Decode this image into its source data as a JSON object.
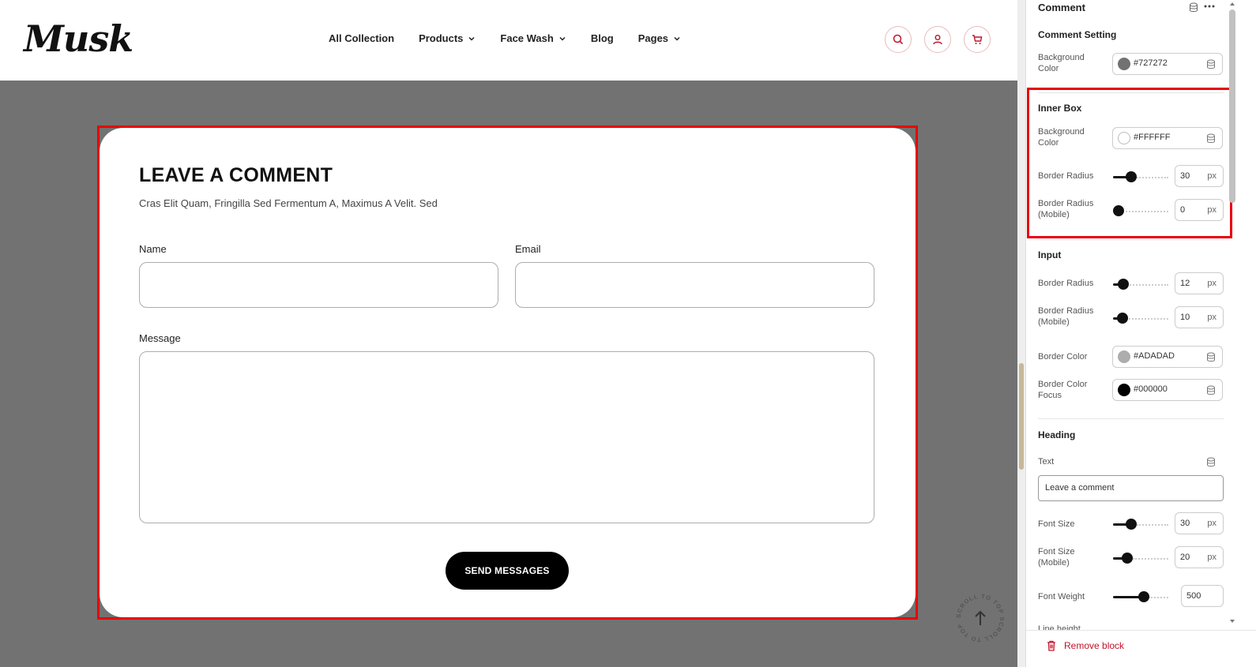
{
  "header": {
    "logo": "Musk",
    "nav": [
      {
        "label": "All Collection",
        "has_dropdown": false
      },
      {
        "label": "Products",
        "has_dropdown": true
      },
      {
        "label": "Face Wash",
        "has_dropdown": true
      },
      {
        "label": "Blog",
        "has_dropdown": false
      },
      {
        "label": "Pages",
        "has_dropdown": true
      }
    ],
    "icons": [
      "search-icon",
      "user-icon",
      "cart-icon"
    ]
  },
  "comment": {
    "title": "LEAVE A COMMENT",
    "subtitle": "Cras Elit Quam, Fringilla Sed Fermentum A, Maximus A Velit. Sed",
    "name_label": "Name",
    "email_label": "Email",
    "message_label": "Message",
    "name_value": "",
    "email_value": "",
    "message_value": "",
    "submit_label": "SEND MESSAGES",
    "scroll_top_text": "SCROLL TO TOP SCROLL TO TOP"
  },
  "panel": {
    "title": "Comment",
    "comment_setting": {
      "heading": "Comment Setting",
      "bg_label": "Background Color",
      "bg_value": "#727272"
    },
    "inner_box": {
      "heading": "Inner Box",
      "bg_label": "Background Color",
      "bg_value": "#FFFFFF",
      "radius_label": "Border Radius",
      "radius_value": "30",
      "radius_mobile_label": "Border Radius (Mobile)",
      "radius_mobile_value": "0"
    },
    "input": {
      "heading": "Input",
      "radius_label": "Border Radius",
      "radius_value": "12",
      "radius_mobile_label": "Border Radius (Mobile)",
      "radius_mobile_value": "10",
      "border_color_label": "Border Color",
      "border_color_value": "#ADADAD",
      "border_focus_label": "Border Color Focus",
      "border_focus_value": "#000000"
    },
    "heading_section": {
      "heading": "Heading",
      "text_label": "Text",
      "text_value": "Leave a comment",
      "font_size_label": "Font Size",
      "font_size_value": "30",
      "font_size_mobile_label": "Font Size (Mobile)",
      "font_size_mobile_value": "20",
      "font_weight_label": "Font Weight",
      "font_weight_value": "500",
      "line_height_label": "Line height"
    },
    "unit": "px",
    "remove_label": "Remove block"
  },
  "colors": {
    "selection": "#e8000b",
    "preview_bg": "#727272",
    "accent_red": "#c0142b"
  }
}
